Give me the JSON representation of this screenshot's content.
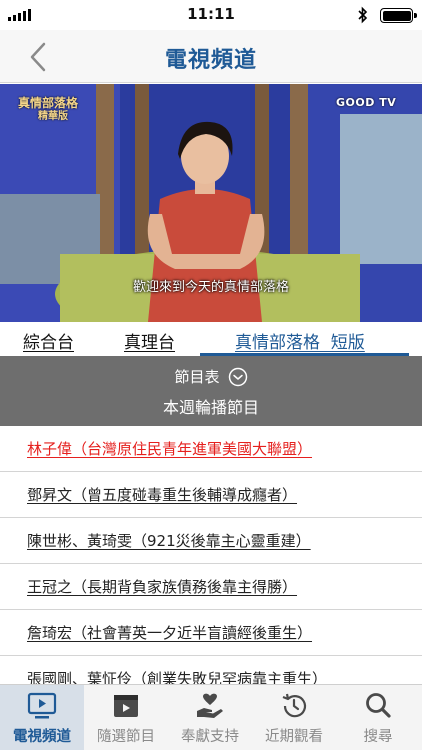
{
  "status_bar": {
    "time": "11:11"
  },
  "nav": {
    "title": "電視頻道"
  },
  "video": {
    "caption": "歡迎來到今天的真情部落格",
    "logo_left_main": "真情部落格",
    "logo_left_sub": "精華版",
    "logo_right": "GOOD TV"
  },
  "channel_tabs": [
    "綜合台",
    "真理台",
    "真情部落格  短版"
  ],
  "schedule": {
    "label": "節目表",
    "subtitle": "本週輪播節目"
  },
  "programs": [
    "林子偉（台灣原住民青年進軍美國大聯盟）",
    "鄧昇文（曾五度碰毒重生後輔導成癮者）",
    "陳世彬、黃琦雯（921災後靠主心靈重建）",
    "王冠之（長期背負家族債務後靠主得勝）",
    "詹琦宏（社會菁英一夕近半盲讀經後重生）",
    "張國剛、葉怔伶（創業失敗兒罕病靠主重生）"
  ],
  "tab_bar": [
    "電視頻道",
    "隨選節目",
    "奉獻支持",
    "近期觀看",
    "搜尋"
  ],
  "colors": {
    "brand": "#1f5a96",
    "highlight": "#e5201e",
    "schedule_bg": "#6e6e6e"
  }
}
